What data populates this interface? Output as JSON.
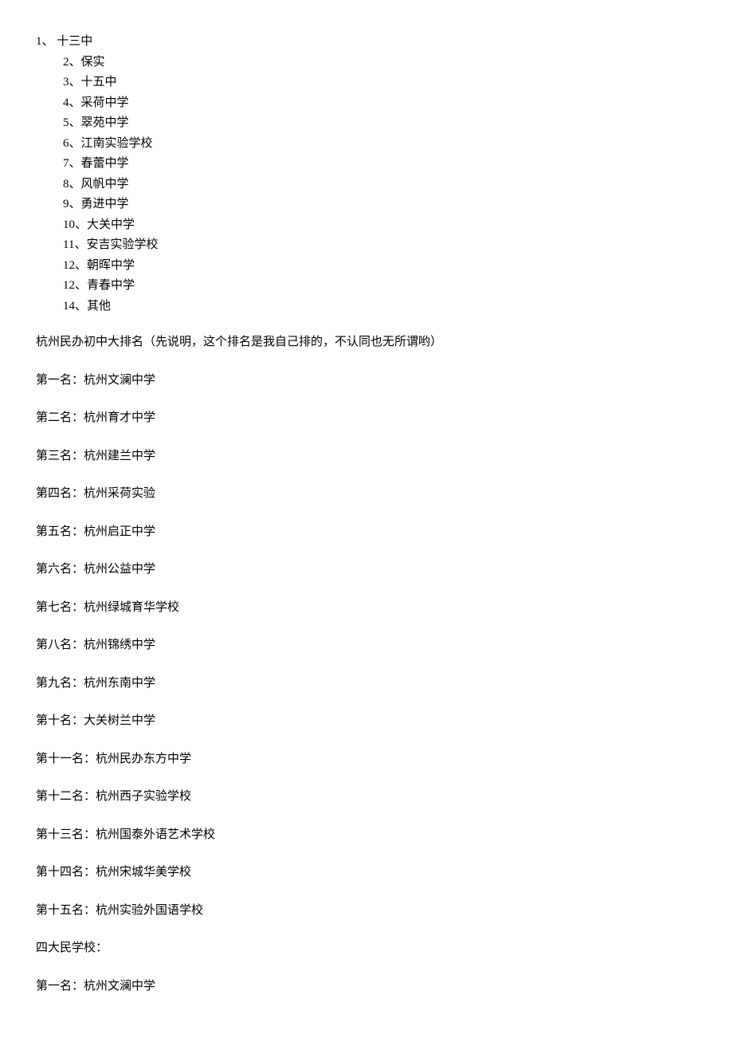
{
  "public_list": [
    {
      "num": "1",
      "sep": "、",
      "name": "十三中",
      "first": true
    },
    {
      "num": "2",
      "sep": "、",
      "name": "保实"
    },
    {
      "num": "3",
      "sep": "、",
      "name": "十五中"
    },
    {
      "num": "4",
      "sep": "、",
      "name": "采荷中学"
    },
    {
      "num": "5",
      "sep": "、",
      "name": "翠苑中学"
    },
    {
      "num": "6",
      "sep": "、",
      "name": "江南实验学校"
    },
    {
      "num": "7",
      "sep": "、",
      "name": "春蕾中学"
    },
    {
      "num": "8",
      "sep": "、",
      "name": "风帆中学"
    },
    {
      "num": "9",
      "sep": "、",
      "name": "勇进中学"
    },
    {
      "num": "10",
      "sep": "、",
      "name": "大关中学"
    },
    {
      "num": "11",
      "sep": "、",
      "name": "安吉实验学校"
    },
    {
      "num": "12",
      "sep": "、",
      "name": "朝晖中学"
    },
    {
      "num": "12",
      "sep": "、",
      "name": "青春中学"
    },
    {
      "num": "14",
      "sep": "、",
      "name": "其他"
    }
  ],
  "heading1": "杭州民办初中大排名（先说明，这个排名是我自己排的，不认同也无所谓哟）",
  "private_ranking": [
    {
      "label": "第一名：杭州文澜中学"
    },
    {
      "label": "第二名：杭州育才中学"
    },
    {
      "label": "第三名：杭州建兰中学"
    },
    {
      "label": "第四名：杭州采荷实验"
    },
    {
      "label": "第五名：杭州启正中学"
    },
    {
      "label": "第六名：杭州公益中学"
    },
    {
      "label": "第七名：杭州绿城育华学校"
    },
    {
      "label": "第八名：杭州锦绣中学"
    },
    {
      "label": "第九名：杭州东南中学"
    },
    {
      "label": "第十名：大关树兰中学"
    },
    {
      "label": "第十一名：杭州民办东方中学"
    },
    {
      "label": "第十二名：杭州西子实验学校"
    },
    {
      "label": "第十三名：杭州国泰外语艺术学校"
    },
    {
      "label": "第十四名：杭州宋城华美学校"
    },
    {
      "label": "第十五名：杭州实验外国语学校"
    }
  ],
  "heading2": "四大民学校：",
  "big4": [
    {
      "label": "第一名：杭州文澜中学"
    }
  ]
}
